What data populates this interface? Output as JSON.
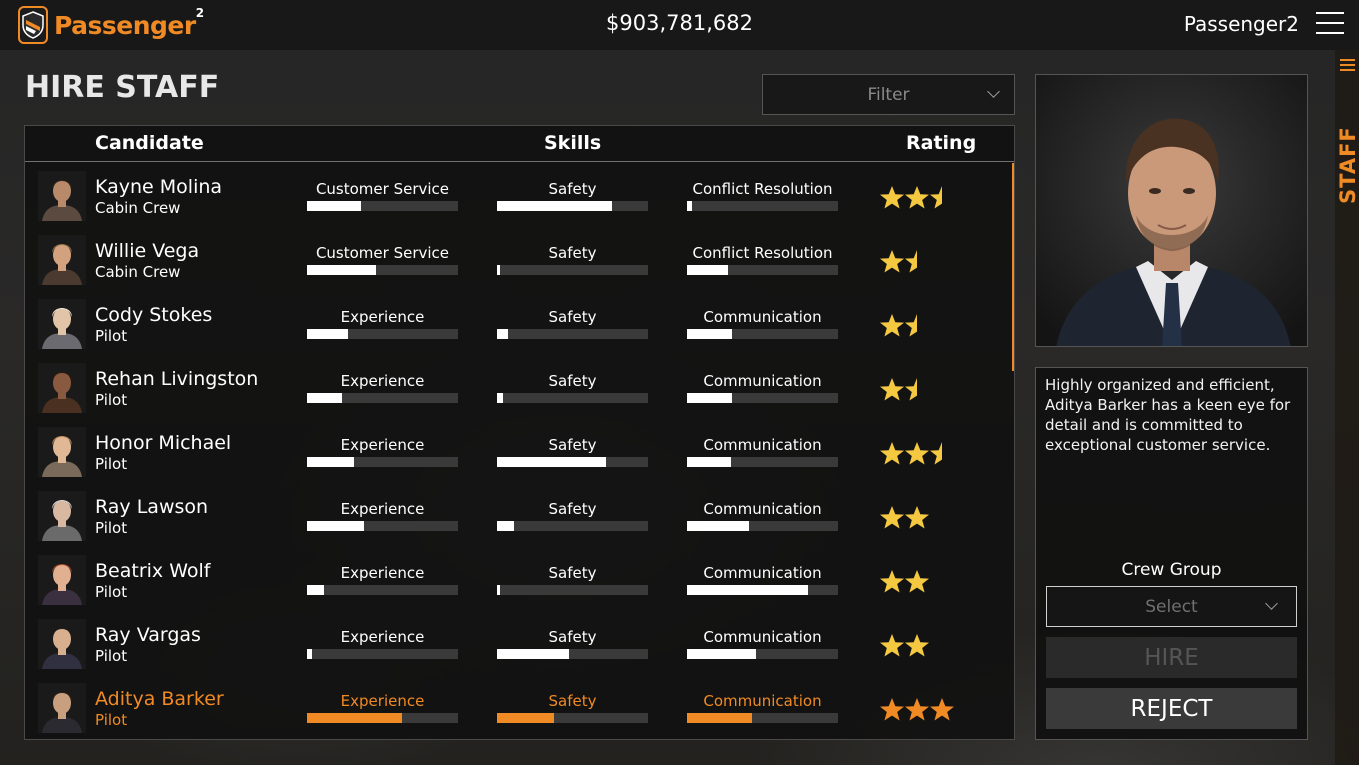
{
  "topbar": {
    "logo_text": "Passenger",
    "logo_sup": "2",
    "money": "$903,781,682",
    "profile_name": "Passenger2"
  },
  "side_tab": {
    "label": "STAFF"
  },
  "page_title": "HIRE STAFF",
  "filter": {
    "placeholder": "Filter"
  },
  "table": {
    "headers": {
      "candidate": "Candidate",
      "skills": "Skills",
      "rating": "Rating"
    },
    "rows": [
      {
        "name": "Kayne Molina",
        "role": "Cabin Crew",
        "skills": [
          {
            "label": "Customer Service",
            "value": 0.36
          },
          {
            "label": "Safety",
            "value": 0.76
          },
          {
            "label": "Conflict Resolution",
            "value": 0.03
          }
        ],
        "rating": 2.5
      },
      {
        "name": "Willie Vega",
        "role": "Cabin Crew",
        "skills": [
          {
            "label": "Customer Service",
            "value": 0.46
          },
          {
            "label": "Safety",
            "value": 0.01
          },
          {
            "label": "Conflict Resolution",
            "value": 0.27
          }
        ],
        "rating": 1.5
      },
      {
        "name": "Cody Stokes",
        "role": "Pilot",
        "skills": [
          {
            "label": "Experience",
            "value": 0.27
          },
          {
            "label": "Safety",
            "value": 0.07
          },
          {
            "label": "Communication",
            "value": 0.3
          }
        ],
        "rating": 1.5
      },
      {
        "name": "Rehan Livingston",
        "role": "Pilot",
        "skills": [
          {
            "label": "Experience",
            "value": 0.23
          },
          {
            "label": "Safety",
            "value": 0.04
          },
          {
            "label": "Communication",
            "value": 0.3
          }
        ],
        "rating": 1.5
      },
      {
        "name": "Honor Michael",
        "role": "Pilot",
        "skills": [
          {
            "label": "Experience",
            "value": 0.31
          },
          {
            "label": "Safety",
            "value": 0.72
          },
          {
            "label": "Communication",
            "value": 0.29
          }
        ],
        "rating": 2.5
      },
      {
        "name": "Ray Lawson",
        "role": "Pilot",
        "skills": [
          {
            "label": "Experience",
            "value": 0.38
          },
          {
            "label": "Safety",
            "value": 0.11
          },
          {
            "label": "Communication",
            "value": 0.41
          }
        ],
        "rating": 2
      },
      {
        "name": "Beatrix Wolf",
        "role": "Pilot",
        "skills": [
          {
            "label": "Experience",
            "value": 0.11
          },
          {
            "label": "Safety",
            "value": 0.01
          },
          {
            "label": "Communication",
            "value": 0.8
          }
        ],
        "rating": 2
      },
      {
        "name": "Ray Vargas",
        "role": "Pilot",
        "skills": [
          {
            "label": "Experience",
            "value": 0.03
          },
          {
            "label": "Safety",
            "value": 0.48
          },
          {
            "label": "Communication",
            "value": 0.46
          }
        ],
        "rating": 2
      },
      {
        "name": "Aditya Barker",
        "role": "Pilot",
        "skills": [
          {
            "label": "Experience",
            "value": 0.63
          },
          {
            "label": "Safety",
            "value": 0.38
          },
          {
            "label": "Communication",
            "value": 0.43
          }
        ],
        "rating": 3,
        "selected": true
      }
    ]
  },
  "detail": {
    "description": "Highly organized and efficient, Aditya Barker has a keen eye for detail and is committed to exceptional customer service.",
    "crew_group_label": "Crew Group",
    "crew_group_select": "Select",
    "hire_label": "HIRE",
    "reject_label": "REJECT"
  },
  "colors": {
    "accent": "#f08a24",
    "star": "#f5c842",
    "star_selected": "#f08a24"
  }
}
